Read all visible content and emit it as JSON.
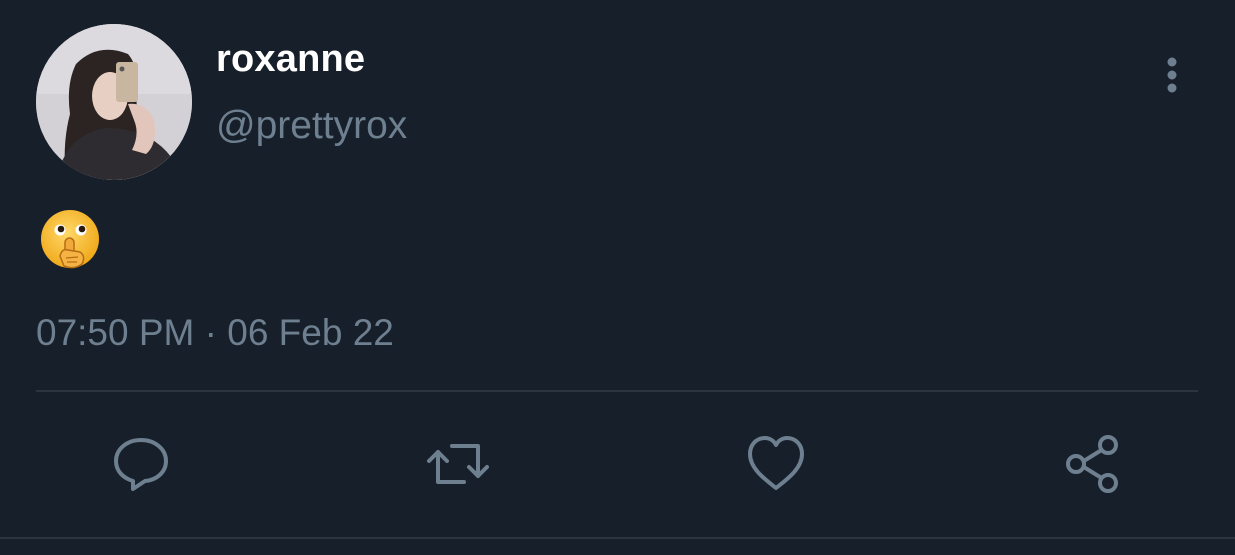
{
  "tweet": {
    "author": {
      "display_name": "roxanne",
      "handle": "@prettyrox"
    },
    "text_emoji": "shushing-face",
    "timestamp": "07:50 PM · 06 Feb 22"
  },
  "actions": {
    "reply": "reply-icon",
    "retweet": "retweet-icon",
    "like": "heart-icon",
    "share": "share-icon"
  },
  "colors": {
    "background": "#17202a",
    "primary_text": "#ffffff",
    "secondary_text": "#6e7f90",
    "divider": "#2b3540"
  }
}
